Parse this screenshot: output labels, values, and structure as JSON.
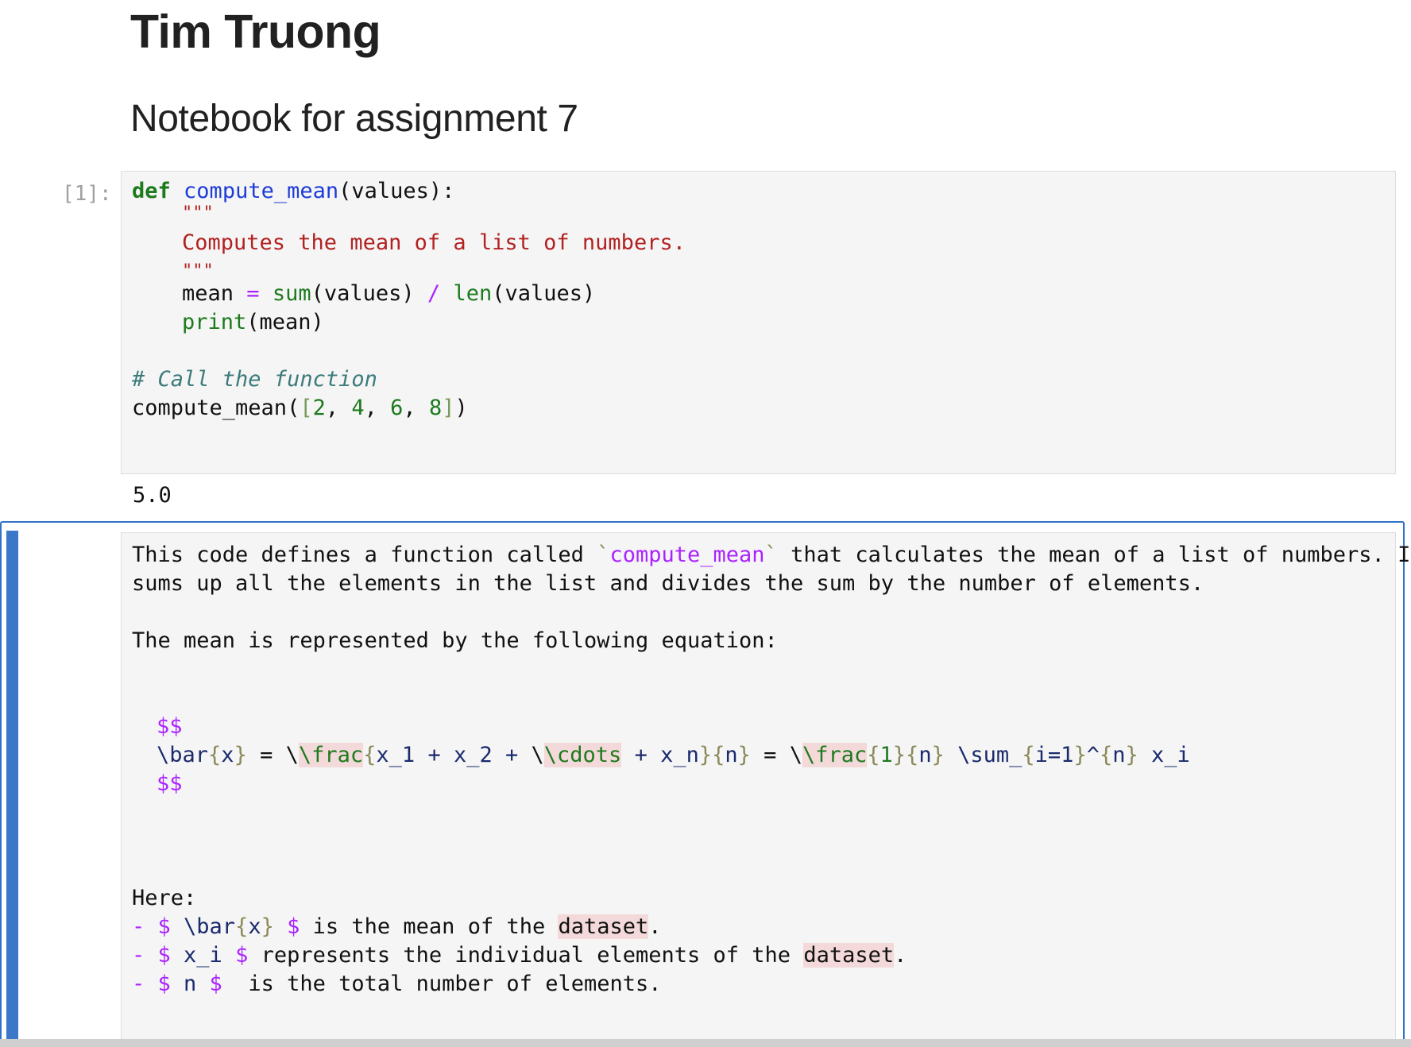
{
  "notebook": {
    "title": "Tim Truong",
    "subtitle": "Notebook for assignment 7"
  },
  "code_cell": {
    "prompt": "[1]:",
    "lines": {
      "l1_kw": "def",
      "l1_fn": "compute_mean",
      "l1_rest": "(values):",
      "l2": "\"\"\"",
      "l3": "Computes the mean of a list of numbers.",
      "l4": "\"\"\"",
      "l5_a": "mean ",
      "l5_eq": "=",
      "l5_b": " ",
      "l5_sum": "sum",
      "l5_c": "(values) ",
      "l5_div": "/",
      "l5_d": " ",
      "l5_len": "len",
      "l5_e": "(values)",
      "l6_print": "print",
      "l6_rest": "(mean)",
      "l7": "# Call the function",
      "l8_fn": "compute_mean(",
      "l8_lb": "[",
      "l8_n1": "2",
      "l8_c1": ", ",
      "l8_n2": "4",
      "l8_c2": ", ",
      "l8_n3": "6",
      "l8_c3": ", ",
      "l8_n4": "8",
      "l8_rb": "]",
      "l8_end": ")"
    },
    "output": "5.0"
  },
  "markdown_cell": {
    "p1_a": "This code defines a function called ",
    "p1_tick1": "`",
    "p1_code": "compute_mean",
    "p1_tick2": "`",
    "p1_b": " that calculates the mean of a list of numbers. It",
    "p1_line2": "sums up all the elements in the list and divides the sum by the number of elements.",
    "p2": "The mean is represented by the following equation:",
    "eq_open": "$$",
    "eq_close": "$$",
    "eq": {
      "bar": "\\bar",
      "lb1": "{",
      "x": "x",
      "rb1": "}",
      "eq1": " = ",
      "frac1": "\\frac",
      "lb2": "{",
      "num": "x_1 + x_2 + ",
      "cdots": "\\cdots",
      "num2": " + x_n",
      "rb2": "}",
      "lb3": "{",
      "n1": "n",
      "rb3": "}",
      "eq2": " = ",
      "frac2": "\\frac",
      "lb4": "{",
      "one": "1",
      "rb4": "}",
      "lb5": "{",
      "n2": "n",
      "rb5": "}",
      "sum": " \\sum_",
      "lb6": "{",
      "idx": "i=1",
      "rb6": "}",
      "caret": "^",
      "lb7": "{",
      "n3": "n",
      "rb7": "}",
      "xi": " x_i"
    },
    "here": "Here:",
    "bullets": [
      {
        "dash": "- ",
        "d1": "$ ",
        "tex_a": "\\bar",
        "lb": "{",
        "tex_b": "x",
        "rb": "}",
        "d2": " $",
        "text_a": " is the mean of the ",
        "hl": "dataset",
        "text_b": "."
      },
      {
        "dash": "- ",
        "d1": "$ ",
        "tex": "x_i",
        "d2": " $",
        "text_a": " represents the individual elements of the ",
        "hl": "dataset",
        "text_b": "."
      },
      {
        "dash": "- ",
        "d1": "$ ",
        "tex": "n",
        "d2": " $",
        "text_a": "  is the total number of elements."
      }
    ]
  }
}
